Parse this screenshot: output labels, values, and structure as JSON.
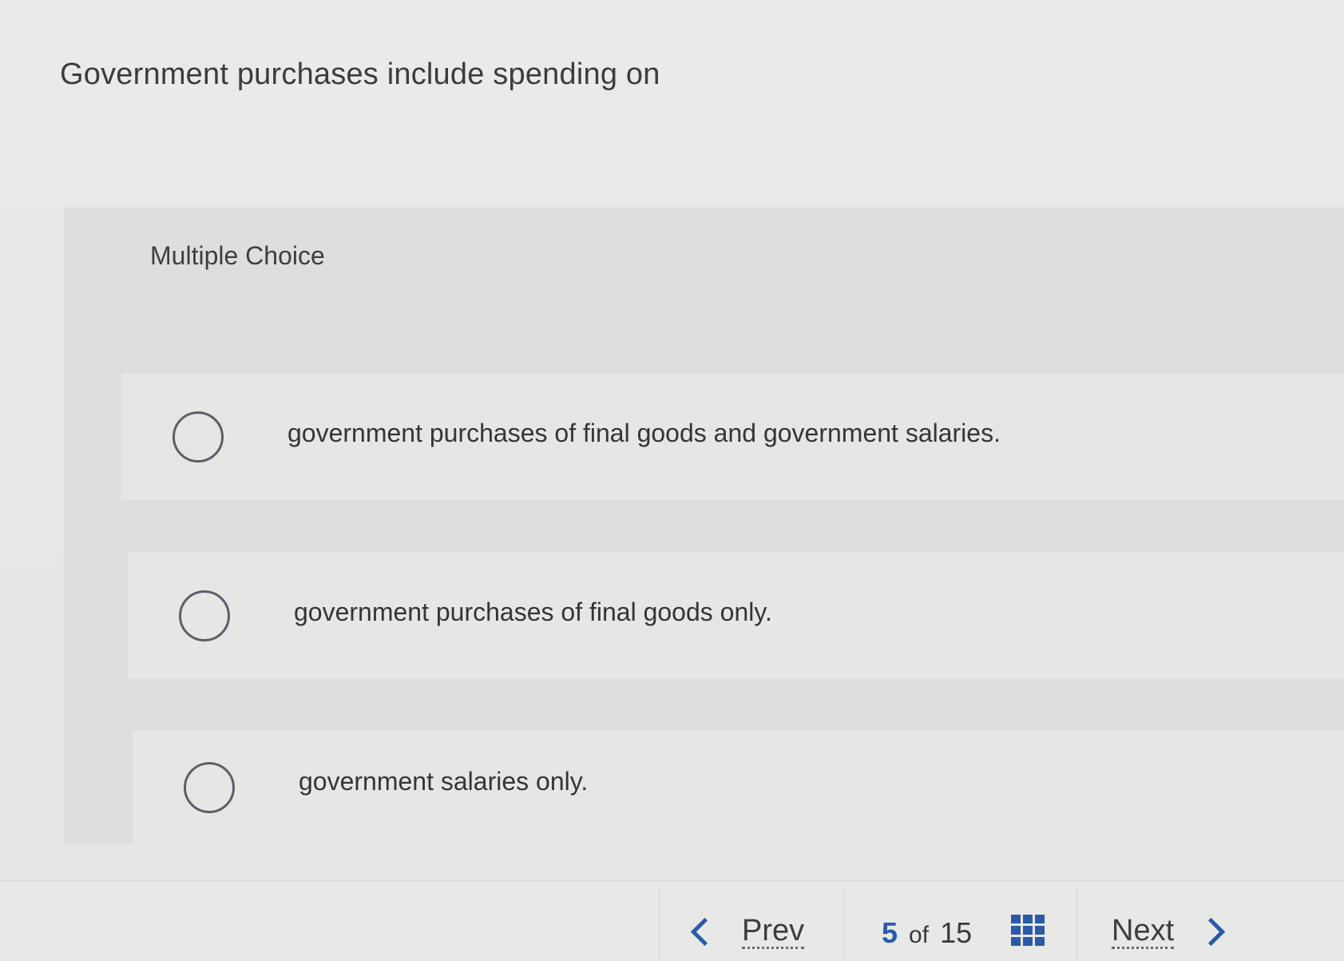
{
  "question": {
    "text": "Government purchases include spending on"
  },
  "multiple_choice": {
    "label": "Multiple Choice",
    "options": [
      {
        "text": "government purchases of final goods and government salaries.",
        "selected": false
      },
      {
        "text": "government purchases of final goods only.",
        "selected": false
      },
      {
        "text": "government salaries only.",
        "selected": false
      }
    ]
  },
  "navigation": {
    "prev_label": "Prev",
    "next_label": "Next",
    "current_page": "5",
    "of_word": "of",
    "total_pages": "15",
    "icons": {
      "prev": "chevron-left-icon",
      "next": "chevron-right-icon",
      "overview": "grid-icon"
    },
    "accent_color": "#2a5aa8"
  }
}
